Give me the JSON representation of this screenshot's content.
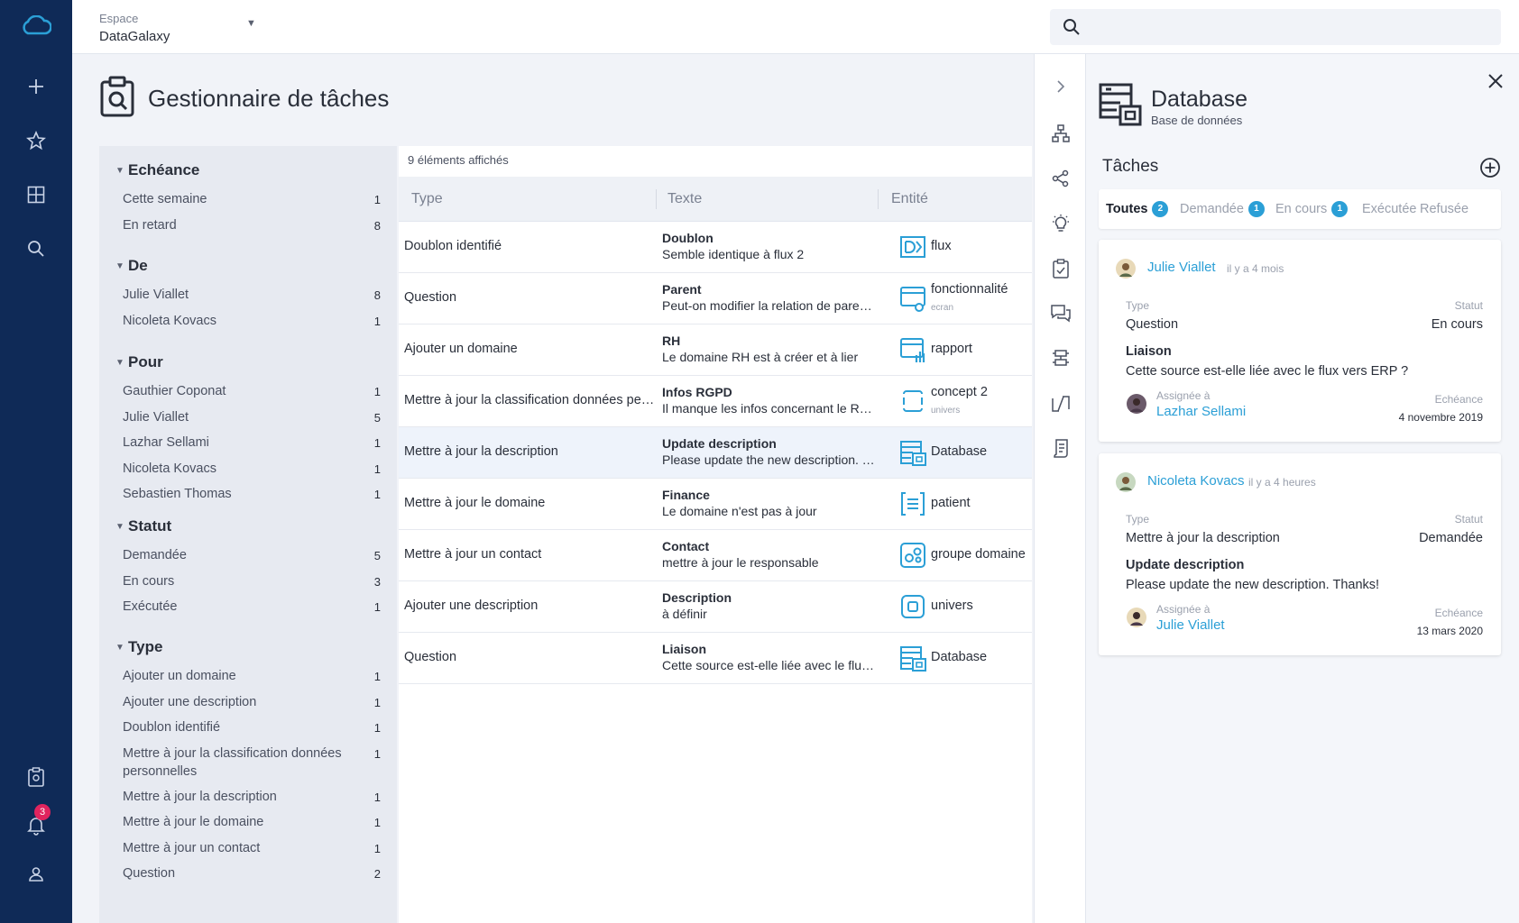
{
  "nav": {
    "notification_count": "3"
  },
  "topbar": {
    "space_label": "Espace",
    "space_name": "DataGalaxy",
    "search_placeholder": ""
  },
  "page": {
    "title": "Gestionnaire de tâches"
  },
  "filters": [
    {
      "title": "Echéance",
      "items": [
        {
          "label": "Cette semaine",
          "count": "1"
        },
        {
          "label": "En retard",
          "count": "8"
        }
      ]
    },
    {
      "title": "De",
      "items": [
        {
          "label": "Julie Viallet",
          "count": "8"
        },
        {
          "label": "Nicoleta Kovacs",
          "count": "1"
        }
      ]
    },
    {
      "title": "Pour",
      "items": [
        {
          "label": "Gauthier Coponat",
          "count": "1"
        },
        {
          "label": "Julie Viallet",
          "count": "5"
        },
        {
          "label": "Lazhar Sellami",
          "count": "1"
        },
        {
          "label": "Nicoleta Kovacs",
          "count": "1"
        },
        {
          "label": "Sebastien Thomas",
          "count": "1"
        }
      ]
    },
    {
      "title": "Statut",
      "items": [
        {
          "label": "Demandée",
          "count": "5"
        },
        {
          "label": "En cours",
          "count": "3"
        },
        {
          "label": "Exécutée",
          "count": "1"
        }
      ]
    },
    {
      "title": "Type",
      "items": [
        {
          "label": "Ajouter un domaine",
          "count": "1"
        },
        {
          "label": "Ajouter une description",
          "count": "1"
        },
        {
          "label": "Doublon identifié",
          "count": "1"
        },
        {
          "label": "Mettre à jour la classification données personnelles",
          "count": "1"
        },
        {
          "label": "Mettre à jour la description",
          "count": "1"
        },
        {
          "label": "Mettre à jour le domaine",
          "count": "1"
        },
        {
          "label": "Mettre à jour un contact",
          "count": "1"
        },
        {
          "label": "Question",
          "count": "2"
        }
      ]
    }
  ],
  "table": {
    "count_text": "9 éléments affichés",
    "columns": {
      "type": "Type",
      "text": "Texte",
      "entity": "Entité"
    },
    "rows": [
      {
        "type": "Doublon identifié",
        "title": "Doublon",
        "text": "Semble identique à flux 2",
        "entity": "flux",
        "entity_sub": "",
        "icon": "flux-icon"
      },
      {
        "type": "Question",
        "title": "Parent",
        "text": "Peut-on modifier la relation de parent ?",
        "entity": "fonctionnalité",
        "entity_sub": "ecran",
        "icon": "feature-icon"
      },
      {
        "type": "Ajouter un domaine",
        "title": "RH",
        "text": "Le domaine RH est à créer et à lier",
        "entity": "rapport",
        "entity_sub": "",
        "icon": "report-icon"
      },
      {
        "type": "Mettre à jour la classification données personnelles",
        "title": "Infos RGPD",
        "text": "Il manque les infos concernant le RGPD",
        "entity": "concept 2",
        "entity_sub": "univers",
        "icon": "concept-icon"
      },
      {
        "type": "Mettre à jour la description",
        "title": "Update description",
        "text": "Please update the new description. Thanks!",
        "entity": "Database",
        "entity_sub": "",
        "icon": "database-icon"
      },
      {
        "type": "Mettre à jour le domaine",
        "title": "Finance",
        "text": "Le domaine n'est pas à jour",
        "entity": "patient",
        "entity_sub": "",
        "icon": "patient-icon"
      },
      {
        "type": "Mettre à jour un contact",
        "title": "Contact",
        "text": "mettre à jour le responsable",
        "entity": "groupe domaine",
        "entity_sub": "",
        "icon": "domain-group-icon"
      },
      {
        "type": "Ajouter une description",
        "title": "Description",
        "text": "à définir",
        "entity": "univers",
        "entity_sub": "",
        "icon": "universe-icon"
      },
      {
        "type": "Question",
        "title": "Liaison",
        "text": "Cette source est-elle liée avec le flux vers ERP ?",
        "entity": "Database",
        "entity_sub": "",
        "icon": "database-icon"
      }
    ]
  },
  "panel": {
    "entity_name": "Database",
    "entity_type": "Base de données",
    "tasks_title": "Tâches",
    "tabs": [
      {
        "label": "Toutes",
        "badge": "2"
      },
      {
        "label": "Demandée",
        "badge": "1"
      },
      {
        "label": "En cours",
        "badge": "1"
      },
      {
        "label": "Exécutée",
        "badge": ""
      },
      {
        "label": "Refusée",
        "badge": ""
      }
    ],
    "cards": [
      {
        "author": "Julie Viallet",
        "time": "il y a 4 mois",
        "type_label": "Type",
        "type": "Question",
        "status_label": "Statut",
        "status": "En cours",
        "title": "Liaison",
        "text": "Cette source est-elle liée avec le flux vers ERP ?",
        "assignee_label": "Assignée à",
        "assignee": "Lazhar Sellami",
        "due_label": "Echéance",
        "due": "4 novembre 2019"
      },
      {
        "author": "Nicoleta Kovacs",
        "time": "il y a 4 heures",
        "type_label": "Type",
        "type": "Mettre à jour la description",
        "status_label": "Statut",
        "status": "Demandée",
        "title": "Update description",
        "text": "Please update the new description. Thanks!",
        "assignee_label": "Assignée à",
        "assignee": "Julie Viallet",
        "due_label": "Echéance",
        "due": "13 mars 2020"
      }
    ]
  },
  "colors": {
    "nav_bg": "#0f2a57",
    "accent": "#2b9fd6",
    "badge_red": "#e0245e"
  }
}
